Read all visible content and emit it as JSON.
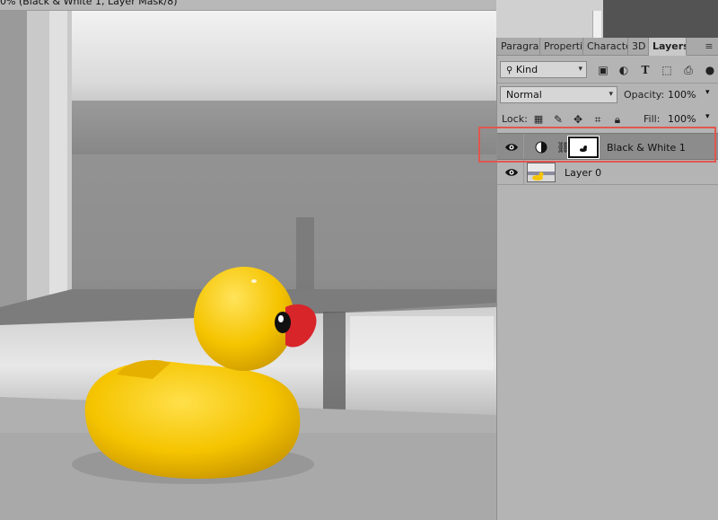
{
  "document": {
    "tab_title": "0% (Black & White 1, Layer Mask/8)"
  },
  "panel": {
    "tabs": [
      {
        "label": "Paragra",
        "active": false
      },
      {
        "label": "Properti",
        "active": false
      },
      {
        "label": "Characte",
        "active": false
      },
      {
        "label": "3D",
        "active": false
      },
      {
        "label": "Layers",
        "active": true
      }
    ],
    "filter": {
      "kind_label": "Kind"
    },
    "blend": {
      "mode": "Normal",
      "opacity_label": "Opacity:",
      "opacity_value": "100%"
    },
    "lock": {
      "label": "Lock:",
      "fill_label": "Fill:",
      "fill_value": "100%"
    },
    "layers": [
      {
        "name": "Black & White 1",
        "selected": true,
        "type": "adjustment"
      },
      {
        "name": "Layer 0",
        "selected": false,
        "type": "image"
      }
    ]
  },
  "colors": {
    "highlight": "#e0574f",
    "panel_bg": "#b4b4b4",
    "selected_row": "#8c8c8c",
    "duck": "#f5c400",
    "beak": "#d8252a"
  }
}
